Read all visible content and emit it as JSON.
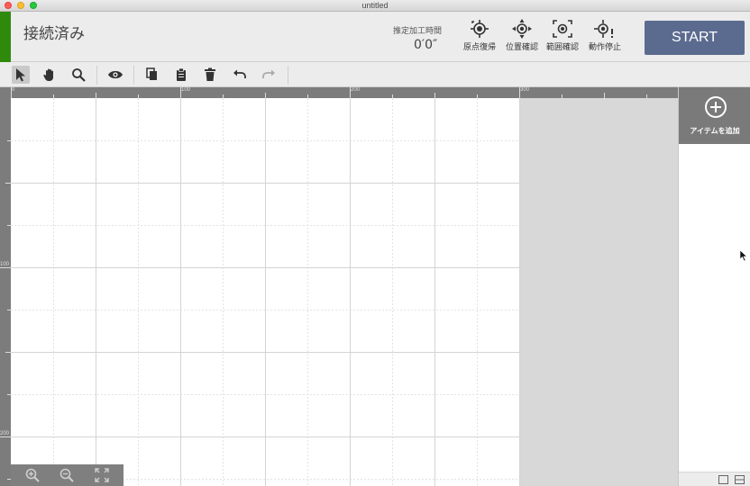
{
  "window": {
    "title": "untitled"
  },
  "header": {
    "status": "接続済み",
    "status_color": "#2f8a0c",
    "time_label": "推定加工時間",
    "time_value": "0′0″",
    "buttons": [
      {
        "label": "原点復帰",
        "icon": "home-origin-icon"
      },
      {
        "label": "位置確認",
        "icon": "position-check-icon"
      },
      {
        "label": "範囲確認",
        "icon": "range-check-icon"
      },
      {
        "label": "動作停止",
        "icon": "stop-motion-icon"
      }
    ],
    "start_label": "START",
    "start_color": "#5b6b8f"
  },
  "toolbar": {
    "tools": [
      "select-arrow-icon",
      "pan-hand-icon",
      "zoom-search-icon",
      "preview-eye-icon",
      "copy-icon",
      "paste-icon",
      "delete-trash-icon",
      "undo-icon",
      "redo-icon"
    ]
  },
  "rulers": {
    "top": [
      "0",
      "100",
      "200",
      "300"
    ],
    "left": [
      "100",
      "200"
    ]
  },
  "right_panel": {
    "add_item_label": "アイテムを追加"
  }
}
